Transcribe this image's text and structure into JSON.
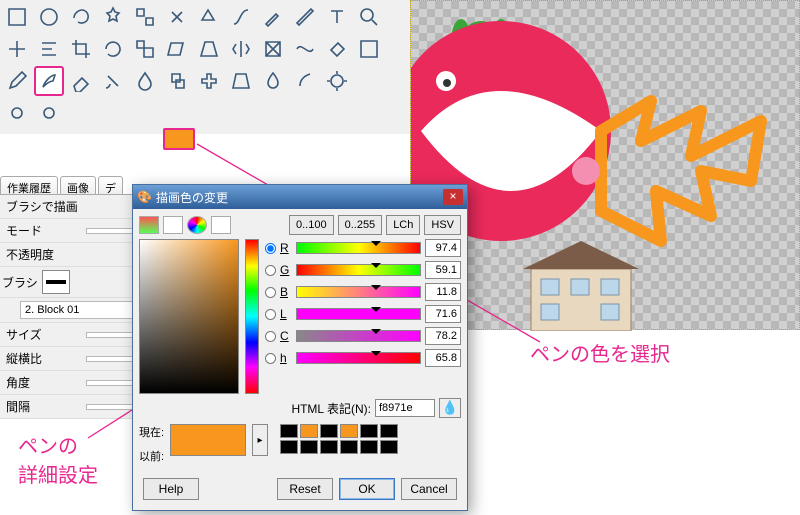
{
  "toolbox": {
    "rows": [
      [
        "rect-select",
        "ellipse-select",
        "lasso",
        "fuzzy",
        "color-select",
        "scissors",
        "foreground",
        "paths",
        "color-picker",
        "measure",
        "text",
        "zoom"
      ],
      [
        "move",
        "align",
        "crop",
        "rotate",
        "scale",
        "shear",
        "perspective",
        "flip",
        "cage",
        "warp",
        "bucket",
        "gradient"
      ],
      [
        "pencil",
        "paintbrush",
        "eraser",
        "airbrush",
        "ink",
        "clone",
        "heal",
        "perspective-clone",
        "blur",
        "smudge",
        "dodge"
      ],
      [
        "brightness",
        "dodge-tool"
      ]
    ],
    "selected": "paintbrush",
    "fg_color": "#f8971e"
  },
  "tabs": [
    "作業履歴",
    "画像",
    "デ"
  ],
  "options": {
    "title": "ブラシで描画",
    "mode_label": "モード",
    "opacity_label": "不透明度",
    "brush_label": "ブラシ",
    "brush_name": "2. Block 01",
    "size_label": "サイズ",
    "aspect_label": "縦横比",
    "angle_label": "角度",
    "spacing_label": "間隔"
  },
  "dialog": {
    "title": "描画色の変更",
    "range_a": "0..100",
    "range_b": "0..255",
    "mode_lch": "LCh",
    "mode_hsv": "HSV",
    "channels": [
      {
        "label": "R",
        "value": "97.4",
        "barclass": "bar-r"
      },
      {
        "label": "G",
        "value": "59.1",
        "barclass": "bar-g"
      },
      {
        "label": "B",
        "value": "11.8",
        "barclass": "bar-b"
      },
      {
        "label": "L",
        "value": "71.6",
        "barclass": "bar-l"
      },
      {
        "label": "C",
        "value": "78.2",
        "barclass": "bar-c"
      },
      {
        "label": "h",
        "value": "65.8",
        "barclass": "bar-h"
      }
    ],
    "html_label": "HTML 表記(N):",
    "html_value": "f8971e",
    "current_label": "現在:",
    "previous_label": "以前:",
    "palette": [
      "#000",
      "#f8971e",
      "#000",
      "#f8971e",
      "#000",
      "#000",
      "#000",
      "#000",
      "#000",
      "#000",
      "#000",
      "#000"
    ],
    "btn_help": "Help",
    "btn_reset": "Reset",
    "btn_ok": "OK",
    "btn_cancel": "Cancel"
  },
  "annotations": {
    "select_color": "ペンの色を選択",
    "detail_settings": "ペンの\n詳細設定"
  }
}
